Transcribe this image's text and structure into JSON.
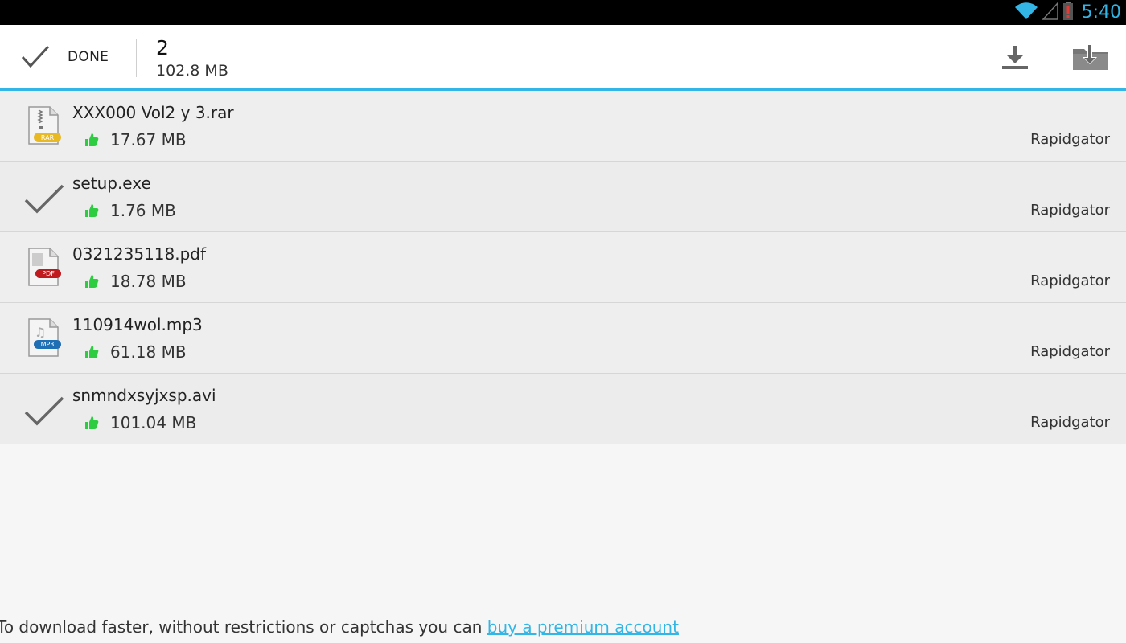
{
  "status_bar": {
    "time": "5:40",
    "icons": [
      "wifi-icon",
      "signal-icon",
      "battery-alert-icon"
    ]
  },
  "action_bar": {
    "done_label": "DONE",
    "selected_count": "2",
    "selected_size": "102.8 MB",
    "actions": [
      "download-icon",
      "save-to-folder-icon"
    ]
  },
  "files": [
    {
      "name": "XXX000 Vol2 y 3.rar",
      "size": "17.67 MB",
      "host": "Rapidgator",
      "icon": "rar-file-icon",
      "selected": false
    },
    {
      "name": "setup.exe",
      "size": "1.76 MB",
      "host": "Rapidgator",
      "icon": "check-icon",
      "selected": true
    },
    {
      "name": "0321235118.pdf",
      "size": "18.78 MB",
      "host": "Rapidgator",
      "icon": "pdf-file-icon",
      "selected": false
    },
    {
      "name": "110914wol.mp3",
      "size": "61.18 MB",
      "host": "Rapidgator",
      "icon": "mp3-file-icon",
      "selected": false
    },
    {
      "name": "snmndxsyjxsp.avi",
      "size": "101.04 MB",
      "host": "Rapidgator",
      "icon": "check-icon",
      "selected": true
    }
  ],
  "footer": {
    "text": "To download faster, without restrictions or captchas you can ",
    "link_text": "buy a premium account"
  },
  "colors": {
    "accent": "#33b5e5",
    "thumb_ok": "#2ecc40",
    "rar_badge": "#e8b923",
    "pdf_badge": "#c0191e",
    "mp3_badge": "#1f6fb5"
  }
}
